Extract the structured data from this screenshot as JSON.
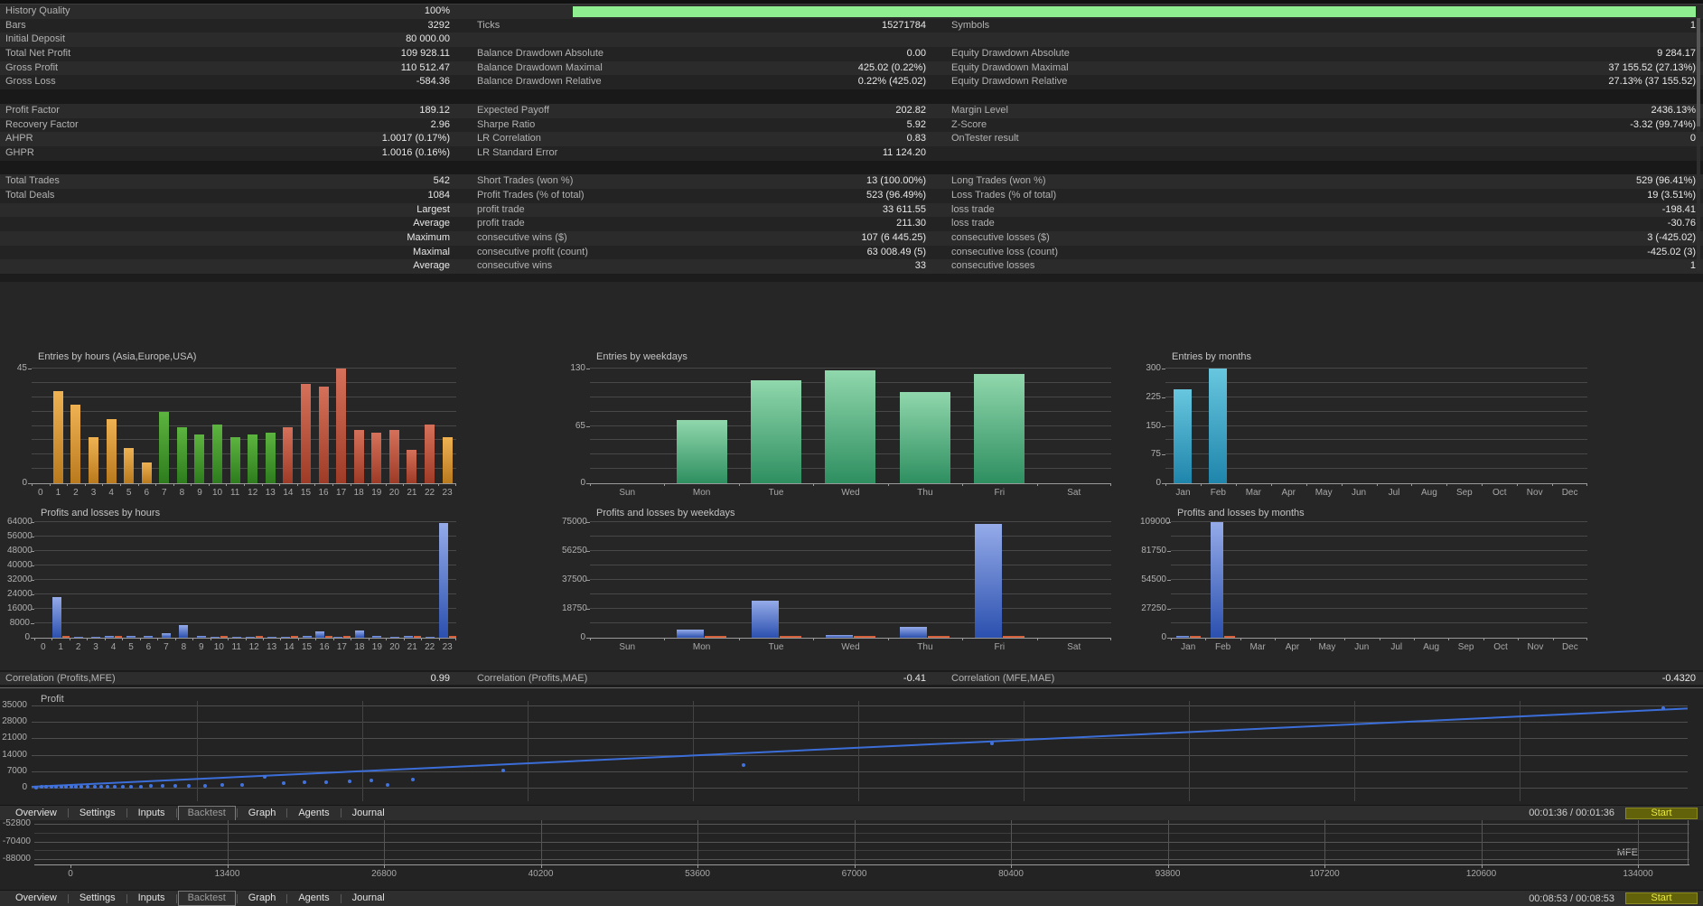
{
  "app": {
    "tabs": [
      "Overview",
      "Settings",
      "Inputs",
      "Backtest",
      "Graph",
      "Agents",
      "Journal"
    ],
    "selected_tab": "Backtest",
    "start_label": "Start",
    "time_top": "00:01:36 / 00:01:36",
    "time_bottom": "00:08:53 / 00:08:53",
    "colors": {
      "progress_green": "#8fee8f",
      "start_bg": "#62620a",
      "start_text": "#e9e93f"
    }
  },
  "stats": {
    "progress": {
      "label": "History Quality",
      "value": "100%"
    },
    "rows": [
      [
        "History Quality",
        "100%",
        "",
        "",
        "",
        ""
      ],
      [
        "Bars",
        "3292",
        "Ticks",
        "15271784",
        "Symbols",
        "1"
      ],
      [
        "Initial Deposit",
        "80 000.00",
        "",
        "",
        "",
        ""
      ],
      [
        "Total Net Profit",
        "109 928.11",
        "Balance Drawdown Absolute",
        "0.00",
        "Equity Drawdown Absolute",
        "9 284.17"
      ],
      [
        "Gross Profit",
        "110 512.47",
        "Balance Drawdown Maximal",
        "425.02 (0.22%)",
        "Equity Drawdown Maximal",
        "37 155.52 (27.13%)"
      ],
      [
        "Gross Loss",
        "-584.36",
        "Balance Drawdown Relative",
        "0.22% (425.02)",
        "Equity Drawdown Relative",
        "27.13% (37 155.52)"
      ],
      "gap",
      [
        "Profit Factor",
        "189.12",
        "Expected Payoff",
        "202.82",
        "Margin Level",
        "2436.13%"
      ],
      [
        "Recovery Factor",
        "2.96",
        "Sharpe Ratio",
        "5.92",
        "Z-Score",
        "-3.32 (99.74%)"
      ],
      [
        "AHPR",
        "1.0017 (0.17%)",
        "LR Correlation",
        "0.83",
        "OnTester result",
        "0"
      ],
      [
        "GHPR",
        "1.0016 (0.16%)",
        "LR Standard Error",
        "11 124.20",
        "",
        ""
      ],
      "gap",
      [
        "Total Trades",
        "542",
        "Short Trades (won %)",
        "13 (100.00%)",
        "Long Trades (won %)",
        "529 (96.41%)"
      ],
      [
        "Total Deals",
        "1084",
        "Profit Trades (% of total)",
        "523 (96.49%)",
        "Loss Trades (% of total)",
        "19 (3.51%)"
      ],
      [
        "",
        "Largest",
        "profit trade",
        "33 611.55",
        "loss trade",
        "-198.41"
      ],
      [
        "",
        "Average",
        "profit trade",
        "211.30",
        "loss trade",
        "-30.76"
      ],
      [
        "",
        "Maximum",
        "consecutive wins ($)",
        "107 (6 445.25)",
        "consecutive losses ($)",
        "3 (-425.02)"
      ],
      [
        "",
        "Maximal",
        "consecutive profit (count)",
        "63 008.49 (5)",
        "consecutive loss (count)",
        "-425.02 (3)"
      ],
      [
        "",
        "Average",
        "consecutive wins",
        "33",
        "consecutive losses",
        "1"
      ]
    ]
  },
  "correlations": [
    {
      "label": "Correlation (Profits,MFE)",
      "value": "0.99"
    },
    {
      "label": "Correlation (Profits,MAE)",
      "value": "-0.41"
    },
    {
      "label": "Correlation (MFE,MAE)",
      "value": "-0.4320"
    }
  ],
  "chart_data": [
    {
      "id": "entries_hours",
      "type": "bar",
      "title": "Entries by hours (Asia,Europe,USA)",
      "ylim": [
        0,
        45
      ],
      "yticks": [
        [
          "45",
          1
        ],
        [
          "0",
          0
        ]
      ],
      "categories": [
        "0",
        "1",
        "2",
        "3",
        "4",
        "5",
        "6",
        "7",
        "8",
        "9",
        "10",
        "11",
        "12",
        "13",
        "14",
        "15",
        "16",
        "17",
        "18",
        "19",
        "20",
        "21",
        "22",
        "23"
      ],
      "values": [
        0,
        36,
        31,
        18,
        25,
        14,
        8,
        28,
        22,
        19,
        23,
        18,
        19,
        20,
        22,
        39,
        38,
        45,
        21,
        20,
        21,
        13,
        23,
        18
      ],
      "bar_colors": [
        "orange",
        "orange",
        "orange",
        "orange",
        "orange",
        "orange",
        "orange",
        "green",
        "green",
        "green",
        "green",
        "green",
        "green",
        "green",
        "red",
        "red",
        "red",
        "red",
        "red",
        "red",
        "red",
        "red",
        "red",
        "orange"
      ]
    },
    {
      "id": "entries_weekdays",
      "type": "bar",
      "title": "Entries by weekdays",
      "ylim": [
        0,
        130
      ],
      "yticks": [
        [
          "130",
          1
        ],
        [
          "65",
          0.5
        ],
        [
          "0",
          0
        ]
      ],
      "categories": [
        "Sun",
        "Mon",
        "Tue",
        "Wed",
        "Thu",
        "Fri",
        "Sat"
      ],
      "values": [
        0,
        72,
        117,
        128,
        103,
        124,
        0
      ],
      "color": "seagreen"
    },
    {
      "id": "entries_months",
      "type": "bar",
      "title": "Entries by months",
      "ylim": [
        0,
        300
      ],
      "yticks": [
        [
          "300",
          1
        ],
        [
          "225",
          0.75
        ],
        [
          "150",
          0.5
        ],
        [
          "75",
          0.25
        ],
        [
          "0",
          0
        ]
      ],
      "categories": [
        "Jan",
        "Feb",
        "Mar",
        "Apr",
        "May",
        "Jun",
        "Jul",
        "Aug",
        "Sep",
        "Oct",
        "Nov",
        "Dec"
      ],
      "values": [
        245,
        300,
        0,
        0,
        0,
        0,
        0,
        0,
        0,
        0,
        0,
        0
      ],
      "color": "teal"
    },
    {
      "id": "pl_hours",
      "type": "plbar",
      "title": "Profits and losses by hours",
      "ylim": [
        0,
        64000
      ],
      "yticks": [
        [
          "64000",
          1
        ],
        [
          "56000",
          0.875
        ],
        [
          "48000",
          0.75
        ],
        [
          "40000",
          0.625
        ],
        [
          "32000",
          0.5
        ],
        [
          "24000",
          0.375
        ],
        [
          "16000",
          0.25
        ],
        [
          "8000",
          0.125
        ],
        [
          "0",
          0
        ]
      ],
      "categories": [
        "0",
        "1",
        "2",
        "3",
        "4",
        "5",
        "6",
        "7",
        "8",
        "9",
        "10",
        "11",
        "12",
        "13",
        "14",
        "15",
        "16",
        "17",
        "18",
        "19",
        "20",
        "21",
        "22",
        "23"
      ],
      "profits": [
        0,
        22500,
        600,
        500,
        1000,
        900,
        900,
        2600,
        7000,
        800,
        600,
        700,
        500,
        700,
        600,
        1000,
        3300,
        700,
        4000,
        900,
        400,
        900,
        500,
        63500
      ],
      "losses": [
        0,
        400,
        0,
        0,
        300,
        0,
        0,
        0,
        0,
        0,
        300,
        0,
        300,
        0,
        300,
        0,
        400,
        300,
        0,
        0,
        0,
        300,
        0,
        600
      ]
    },
    {
      "id": "pl_weekdays",
      "type": "plbar",
      "title": "Profits and losses by weekdays",
      "ylim": [
        0,
        75000
      ],
      "yticks": [
        [
          "75000",
          1
        ],
        [
          "56250",
          0.75
        ],
        [
          "37500",
          0.5
        ],
        [
          "18750",
          0.25
        ],
        [
          "0",
          0
        ]
      ],
      "categories": [
        "Sun",
        "Mon",
        "Tue",
        "Wed",
        "Thu",
        "Fri",
        "Sat"
      ],
      "profits": [
        0,
        5000,
        24000,
        2000,
        7000,
        74000,
        0
      ],
      "losses": [
        0,
        400,
        500,
        400,
        500,
        1200,
        0
      ]
    },
    {
      "id": "pl_months",
      "type": "plbar",
      "title": "Profits and losses by months",
      "ylim": [
        0,
        109000
      ],
      "yticks": [
        [
          "109000",
          1
        ],
        [
          "81750",
          0.75
        ],
        [
          "54500",
          0.5
        ],
        [
          "27250",
          0.25
        ],
        [
          "0",
          0
        ]
      ],
      "categories": [
        "Jan",
        "Feb",
        "Mar",
        "Apr",
        "May",
        "Jun",
        "Jul",
        "Aug",
        "Sep",
        "Oct",
        "Nov",
        "Dec"
      ],
      "profits": [
        2000,
        109000,
        0,
        0,
        0,
        0,
        0,
        0,
        0,
        0,
        0,
        0
      ],
      "losses": [
        400,
        1300,
        0,
        0,
        0,
        0,
        0,
        0,
        0,
        0,
        0,
        0
      ]
    },
    {
      "id": "profit_scatter",
      "type": "scatter",
      "legend": "Profit",
      "ylim": [
        0,
        35000
      ],
      "yticks": [
        [
          "35000",
          1
        ],
        [
          "28000",
          0.8
        ],
        [
          "21000",
          0.6
        ],
        [
          "14000",
          0.4
        ],
        [
          "7000",
          0.2
        ],
        [
          "0",
          0
        ]
      ],
      "trend": {
        "x1": 0,
        "v1": 300,
        "x2": 1,
        "v2": 33600
      },
      "points": [
        [
          0.003,
          150
        ],
        [
          0.006,
          250
        ],
        [
          0.009,
          200
        ],
        [
          0.012,
          300
        ],
        [
          0.015,
          250
        ],
        [
          0.018,
          350
        ],
        [
          0.021,
          300
        ],
        [
          0.024,
          280
        ],
        [
          0.027,
          400
        ],
        [
          0.03,
          350
        ],
        [
          0.034,
          300
        ],
        [
          0.038,
          450
        ],
        [
          0.042,
          400
        ],
        [
          0.046,
          380
        ],
        [
          0.05,
          500
        ],
        [
          0.055,
          450
        ],
        [
          0.06,
          480
        ],
        [
          0.066,
          550
        ],
        [
          0.072,
          600
        ],
        [
          0.079,
          650
        ],
        [
          0.087,
          700
        ],
        [
          0.095,
          800
        ],
        [
          0.105,
          900
        ],
        [
          0.115,
          1000
        ],
        [
          0.127,
          1200
        ],
        [
          0.141,
          4600
        ],
        [
          0.152,
          1900
        ],
        [
          0.165,
          2200
        ],
        [
          0.178,
          2500
        ],
        [
          0.192,
          2700
        ],
        [
          0.205,
          2900
        ],
        [
          0.215,
          1100
        ],
        [
          0.23,
          3600
        ],
        [
          0.285,
          7300
        ],
        [
          0.43,
          9600
        ],
        [
          0.58,
          18800
        ],
        [
          0.985,
          34000
        ]
      ]
    },
    {
      "id": "mfe_view",
      "type": "axis_view",
      "right_label": "MFE",
      "ylabels": [
        "-52800",
        "-70400",
        "-88000"
      ],
      "xlabels": [
        "0",
        "13400",
        "26800",
        "40200",
        "53600",
        "67000",
        "80400",
        "93800",
        "107200",
        "120600",
        "134000"
      ]
    }
  ]
}
